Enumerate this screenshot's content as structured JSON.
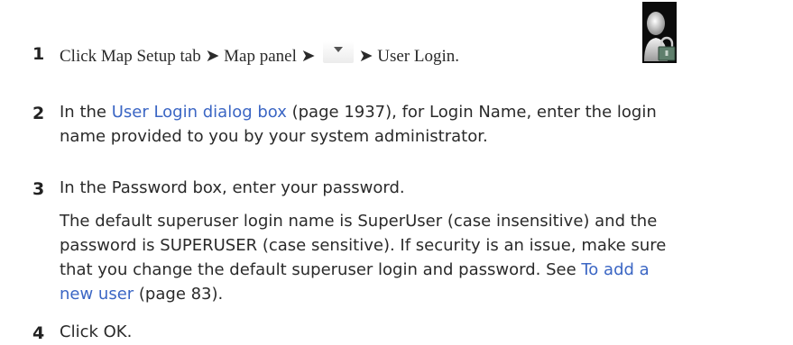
{
  "steps": [
    {
      "number": "1",
      "part1": "Click Map Setup tab",
      "arrow1": "➤",
      "part2": "Map panel",
      "arrow2": "➤",
      "arrow3": "➤",
      "part3": "User Login."
    },
    {
      "number": "2",
      "prefix": "In the ",
      "link_text": "User Login dialog box",
      "page_ref": " (page 1937), for Login Name, enter the login",
      "line2": "name provided to you by your system administrator."
    },
    {
      "number": "3",
      "text": "In the Password box, enter your password.",
      "note_line1": "The default superuser login name is SuperUser (case insensitive) and the",
      "note_line2": "password is SUPERUSER (case sensitive). If security is an issue, make sure",
      "note_line3_prefix": "that you change the default superuser login and password. See ",
      "note_link_part1": "To add a",
      "note_link_part2": "new user",
      "note_page_ref": " (page 83)."
    },
    {
      "number": "4",
      "text": "Click OK."
    }
  ],
  "colors": {
    "link": "#3b66c4",
    "text": "#2a2a2a",
    "icon_background": "#0b0b0b"
  },
  "icons": {
    "dropdown": "chevron-down-icon",
    "user_login": "user-lock-icon"
  }
}
